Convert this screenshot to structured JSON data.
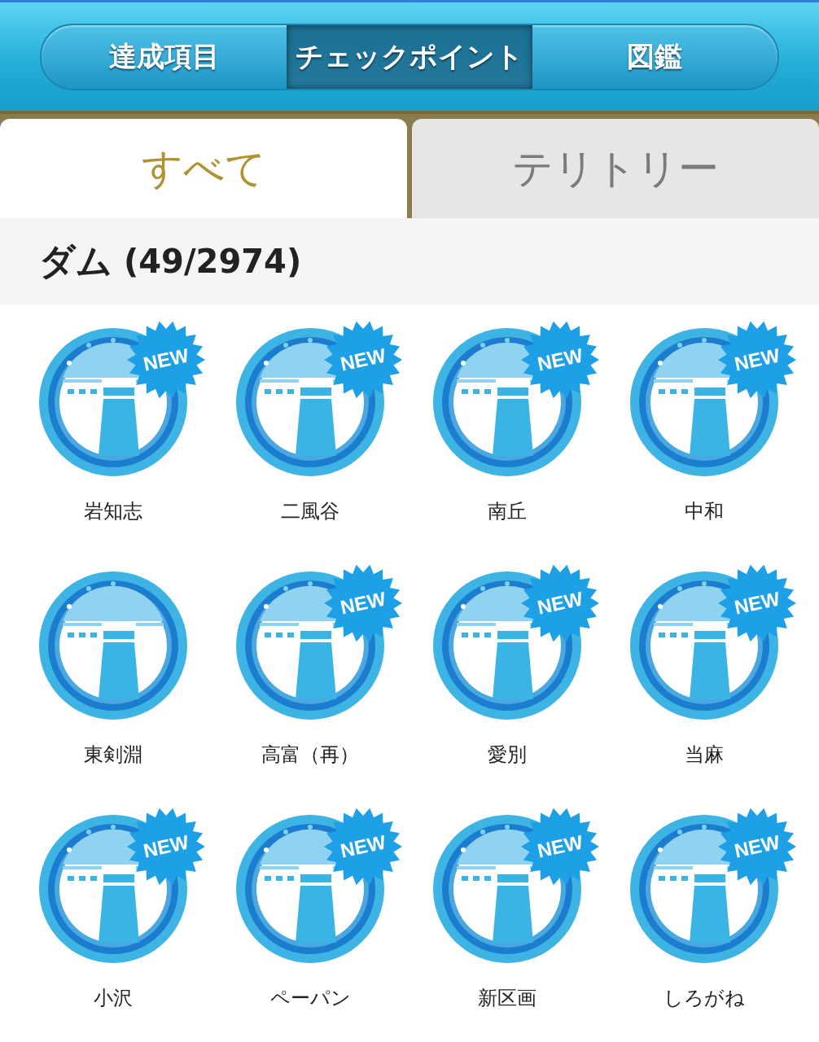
{
  "segments": [
    {
      "label": "達成項目",
      "selected": false
    },
    {
      "label": "チェックポイント",
      "selected": true
    },
    {
      "label": "図鑑",
      "selected": false
    }
  ],
  "subtabs": [
    {
      "label": "すべて",
      "selected": true
    },
    {
      "label": "テリトリー",
      "selected": false
    }
  ],
  "section": {
    "title": "ダム",
    "count": "(49/2974)"
  },
  "items": [
    {
      "name": "岩知志",
      "badge": "NEW"
    },
    {
      "name": "二風谷",
      "badge": "NEW"
    },
    {
      "name": "南丘",
      "badge": "NEW"
    },
    {
      "name": "中和",
      "badge": "NEW"
    },
    {
      "name": "東剣淵"
    },
    {
      "name": "高富（再）",
      "badge": "NEW"
    },
    {
      "name": "愛別",
      "badge": "NEW"
    },
    {
      "name": "当麻",
      "badge": "NEW"
    },
    {
      "name": "小沢",
      "badge": "NEW"
    },
    {
      "name": "ペーパン",
      "badge": "NEW"
    },
    {
      "name": "新区画",
      "badge": "NEW"
    },
    {
      "name": "しろがね",
      "badge": "NEW"
    }
  ]
}
